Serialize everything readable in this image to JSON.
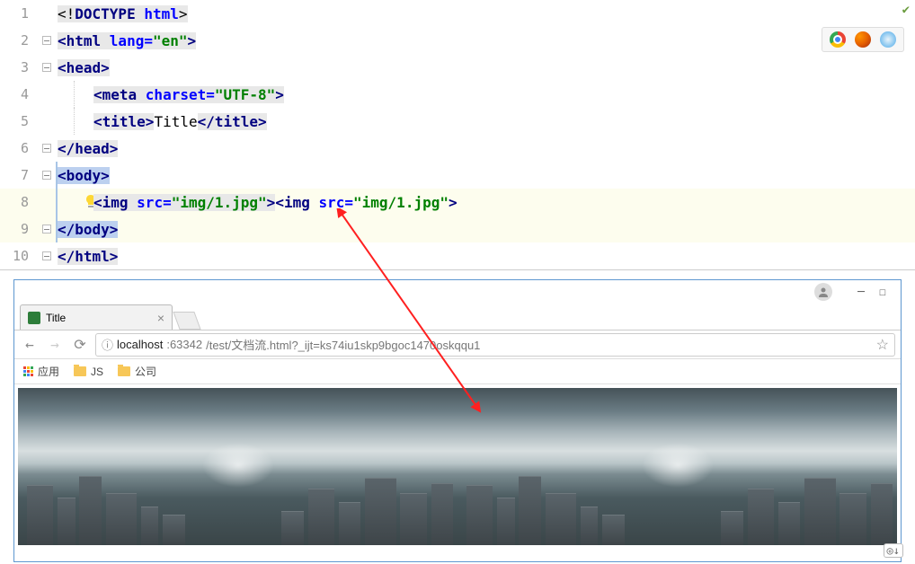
{
  "editor": {
    "lines": [
      {
        "num": "1",
        "hasFold": false
      },
      {
        "num": "2",
        "hasFold": true
      },
      {
        "num": "3",
        "hasFold": true
      },
      {
        "num": "4",
        "hasFold": false
      },
      {
        "num": "5",
        "hasFold": false
      },
      {
        "num": "6",
        "hasFold": true
      },
      {
        "num": "7",
        "hasFold": true
      },
      {
        "num": "8",
        "hasFold": false
      },
      {
        "num": "9",
        "hasFold": true
      },
      {
        "num": "10",
        "hasFold": true
      }
    ],
    "tokens": {
      "doctype_open": "<!",
      "doctype": "DOCTYPE ",
      "html_kw": "html",
      "gt": ">",
      "html_open": "<html ",
      "lang_attr": "lang=",
      "lang_val": "\"en\"",
      "head_open": "<head>",
      "meta_open": "<meta ",
      "charset_attr": "charset=",
      "charset_val": "\"UTF-8\"",
      "title_open": "<title>",
      "title_text": "Title",
      "title_close": "</title>",
      "head_close": "</head>",
      "body_open": "<body>",
      "img_open": "<img ",
      "src_attr": "src=",
      "src_val": "\"img/1.jpg\"",
      "body_close": "</body>",
      "html_close": "</html>"
    },
    "browser_preview_icons": {
      "chrome": "chrome-icon",
      "firefox": "firefox-icon",
      "safari": "safari-icon"
    }
  },
  "browser": {
    "tab_title": "Title",
    "url_host": "localhost",
    "url_port": ":63342",
    "url_path": "/test/文档流.html?_ijt=ks74iu1skp9bgoc1470oskqqu1",
    "info_icon": "ⓘ",
    "bookmarks": {
      "apps": "应用",
      "js": "JS",
      "company": "公司"
    }
  }
}
